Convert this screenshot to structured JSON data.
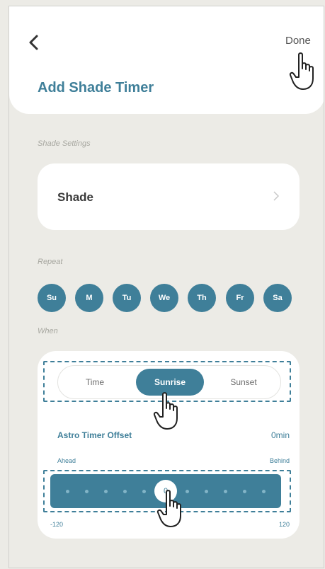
{
  "header": {
    "back_icon": "chevron-left-icon",
    "done_label": "Done",
    "title": "Add Shade Timer"
  },
  "shade_settings": {
    "section_label": "Shade Settings",
    "shade_label": "Shade",
    "chevron_icon": "chevron-right-icon"
  },
  "repeat": {
    "section_label": "Repeat",
    "days": [
      "Su",
      "M",
      "Tu",
      "We",
      "Th",
      "Fr",
      "Sa"
    ]
  },
  "when": {
    "section_label": "When",
    "modes": [
      "Time",
      "Sunrise",
      "Sunset"
    ],
    "selected_mode": "Sunrise",
    "offset_label": "Astro Timer Offset",
    "offset_value": "0min",
    "ahead_label": "Ahead",
    "behind_label": "Behind",
    "slider": {
      "value": "0",
      "min": "-120",
      "max": "120"
    }
  },
  "colors": {
    "accent": "#3f7f99",
    "background": "#ecebe6",
    "card": "#ffffff"
  },
  "annotations": {
    "hand_icon": "hand-pointer-icon"
  }
}
